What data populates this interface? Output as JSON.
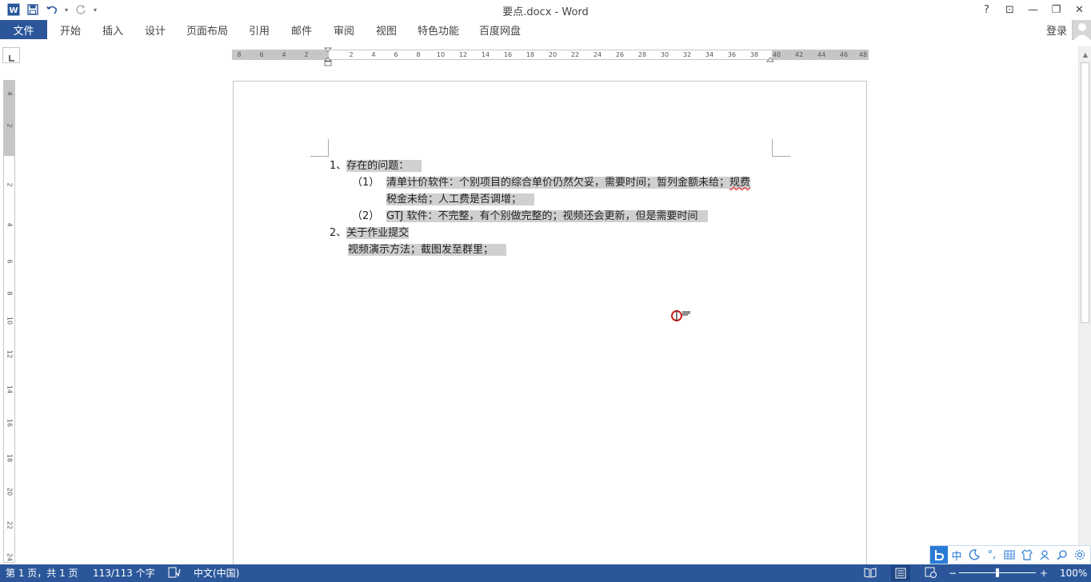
{
  "window": {
    "title": "要点.docx - Word",
    "help": "?",
    "ribbon_display": "⊡",
    "minimize": "—",
    "restore": "❐",
    "close": "✕"
  },
  "qat": {
    "undo_caret": "▾",
    "customize": "▾"
  },
  "ribbon": {
    "file_tab": "文件",
    "tabs": [
      "开始",
      "插入",
      "设计",
      "页面布局",
      "引用",
      "邮件",
      "审阅",
      "视图",
      "特色功能",
      "百度网盘"
    ],
    "login": "登录"
  },
  "ruler": {
    "h_left": [
      "8",
      "6",
      "4",
      "2"
    ],
    "h_right": [
      "2",
      "4",
      "6",
      "8",
      "10",
      "12",
      "14",
      "16",
      "18",
      "20",
      "22",
      "24",
      "26",
      "28",
      "30",
      "32",
      "34",
      "36",
      "38",
      "40",
      "42",
      "44",
      "46",
      "48"
    ],
    "v_top": [
      "4",
      "2"
    ],
    "v_main": [
      "2",
      "4",
      "6",
      "8",
      "10",
      "12",
      "14",
      "16",
      "18",
      "20",
      "22",
      "24"
    ]
  },
  "document": {
    "lines": [
      {
        "prefix": "1、",
        "text": "存在的问题："
      },
      {
        "prefix": "（1）",
        "text": "清单计价软件：个别项目的综合单价仍然欠妥，需要时间；暂列金额未给；",
        "squig": "规费"
      },
      {
        "prefix": "",
        "text": "税金未给；人工费是否调增；"
      },
      {
        "prefix": "（2）",
        "text": "GTJ 软件：不完整，有个别做完整的；视频还会更新，但是需要时间"
      },
      {
        "prefix": "2、",
        "text": "关于作业提交"
      },
      {
        "prefix": "",
        "text": "视频演示方法；截图发至群里；"
      }
    ]
  },
  "status": {
    "page": "第 1 页，共 1 页",
    "words": "113/113 个字",
    "language": "中文(中国)",
    "zoom_minus": "−",
    "zoom_plus": "+",
    "zoom": "100%",
    "zoom_level": 100
  },
  "ime": {
    "lang": "中",
    "punct": "°,"
  },
  "colors": {
    "accent": "#2b579a",
    "highlight": "#d0d0d0",
    "cursor": "#d02020"
  }
}
